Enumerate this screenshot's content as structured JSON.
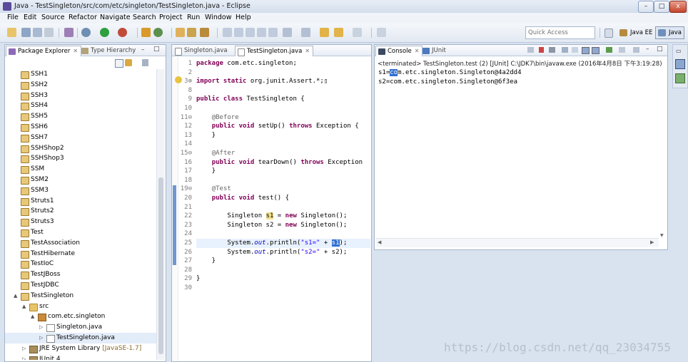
{
  "window": {
    "title": "Java - TestSingleton/src/com/etc/singleton/TestSingleton.java - Eclipse",
    "minimize": "–",
    "maximize": "□",
    "close": "x"
  },
  "menu": [
    "File",
    "Edit",
    "Source",
    "Refactor",
    "Navigate",
    "Search",
    "Project",
    "Run",
    "Window",
    "Help"
  ],
  "toolbar": {
    "quick_access_placeholder": "Quick Access",
    "perspectives": [
      "Java EE",
      "Java"
    ]
  },
  "package_explorer": {
    "tabs": [
      "Package Explorer",
      "Type Hierarchy"
    ],
    "items": [
      {
        "label": "SSH1",
        "indent": 0,
        "icon": "project"
      },
      {
        "label": "SSH2",
        "indent": 0,
        "icon": "project"
      },
      {
        "label": "SSH3",
        "indent": 0,
        "icon": "project"
      },
      {
        "label": "SSH4",
        "indent": 0,
        "icon": "project"
      },
      {
        "label": "SSH5",
        "indent": 0,
        "icon": "project"
      },
      {
        "label": "SSH6",
        "indent": 0,
        "icon": "project"
      },
      {
        "label": "SSH7",
        "indent": 0,
        "icon": "project"
      },
      {
        "label": "SSHShop2",
        "indent": 0,
        "icon": "project"
      },
      {
        "label": "SSHShop3",
        "indent": 0,
        "icon": "project"
      },
      {
        "label": "SSM",
        "indent": 0,
        "icon": "project"
      },
      {
        "label": "SSM2",
        "indent": 0,
        "icon": "project"
      },
      {
        "label": "SSM3",
        "indent": 0,
        "icon": "project"
      },
      {
        "label": "Struts1",
        "indent": 0,
        "icon": "project"
      },
      {
        "label": "Struts2",
        "indent": 0,
        "icon": "project"
      },
      {
        "label": "Struts3",
        "indent": 0,
        "icon": "project"
      },
      {
        "label": "Test",
        "indent": 0,
        "icon": "project"
      },
      {
        "label": "TestAssociation",
        "indent": 0,
        "icon": "project"
      },
      {
        "label": "TestHibernate",
        "indent": 0,
        "icon": "project"
      },
      {
        "label": "TestIoC",
        "indent": 0,
        "icon": "project"
      },
      {
        "label": "TestJBoss",
        "indent": 0,
        "icon": "project"
      },
      {
        "label": "TestJDBC",
        "indent": 0,
        "icon": "project"
      },
      {
        "label": "TestSingleton",
        "indent": 0,
        "icon": "project",
        "arrow": "▲"
      },
      {
        "label": "src",
        "indent": 1,
        "icon": "folder",
        "arrow": "▲"
      },
      {
        "label": "com.etc.singleton",
        "indent": 2,
        "icon": "package",
        "arrow": "▲"
      },
      {
        "label": "Singleton.java",
        "indent": 3,
        "icon": "java",
        "arrow": "▷"
      },
      {
        "label": "TestSingleton.java",
        "indent": 3,
        "icon": "java",
        "arrow": "▷",
        "selected": true
      },
      {
        "label": "JRE System Library",
        "suffix": "[JavaSE-1.7]",
        "indent": 1,
        "icon": "library",
        "arrow": "▷"
      },
      {
        "label": "JUnit 4",
        "indent": 1,
        "icon": "library",
        "arrow": "▷"
      }
    ]
  },
  "editor": {
    "tabs": [
      "Singleton.java",
      "TestSingleton.java"
    ],
    "lines": [
      {
        "n": "1",
        "html": "<span class='kw'>package</span> com.etc.singleton;"
      },
      {
        "n": "2",
        "html": ""
      },
      {
        "n": "3⊕",
        "html": "<span class='kw'>import static</span> org.junit.Assert.*;▯"
      },
      {
        "n": "8",
        "html": ""
      },
      {
        "n": "9",
        "html": "<span class='kw'>public class</span> TestSingleton {"
      },
      {
        "n": "10",
        "html": ""
      },
      {
        "n": "11⊖",
        "html": "    <span class='ann'>@Before</span>"
      },
      {
        "n": "12",
        "html": "    <span class='kw'>public void</span> setUp() <span class='kw'>throws</span> Exception {"
      },
      {
        "n": "13",
        "html": "    }"
      },
      {
        "n": "14",
        "html": ""
      },
      {
        "n": "15⊖",
        "html": "    <span class='ann'>@After</span>"
      },
      {
        "n": "16",
        "html": "    <span class='kw'>public void</span> tearDown() <span class='kw'>throws</span> Exception"
      },
      {
        "n": "17",
        "html": "    }"
      },
      {
        "n": "18",
        "html": ""
      },
      {
        "n": "19⊖",
        "html": "    <span class='ann'>@Test</span>"
      },
      {
        "n": "20",
        "html": "    <span class='kw'>public void</span> test() {"
      },
      {
        "n": "21",
        "html": ""
      },
      {
        "n": "22",
        "html": "        Singleton <span class='hl'>s1</span> = <span class='kw'>new</span> Singleton();"
      },
      {
        "n": "23",
        "html": "        Singleton s2 = <span class='kw'>new</span> Singleton();"
      },
      {
        "n": "24",
        "html": ""
      },
      {
        "n": "25",
        "html": "        System.<span class='fld'>out</span>.println(<span class='str'>\"s1=\"</span> + <span class='sel'>s1</span>);",
        "current": true
      },
      {
        "n": "26",
        "html": "        System.<span class='fld'>out</span>.println(<span class='str'>\"s2=\"</span> + s2);"
      },
      {
        "n": "27",
        "html": "    }"
      },
      {
        "n": "28",
        "html": ""
      },
      {
        "n": "29",
        "html": "}"
      },
      {
        "n": "30",
        "html": ""
      }
    ]
  },
  "console": {
    "tabs": [
      "Console",
      "JUnit"
    ],
    "status": "<terminated> TestSingleton.test (2) [JUnit] C:\\JDK7\\bin\\javaw.exe (2016年4月8日 下午3:19:28)",
    "lines": [
      {
        "pre": "s1=",
        "sel": "co",
        "post": "m.etc.singleton.Singleton@4a2dd4"
      },
      {
        "pre": "s2=com.etc.singleton.Singleton@6f3ea",
        "sel": "",
        "post": ""
      }
    ]
  },
  "watermark": "https://blog.csdn.net/qq_23034755",
  "colors": {
    "accent": "#2f6fd0",
    "keyword": "#7f0055",
    "string": "#2a00ff",
    "annotation": "#646464"
  }
}
